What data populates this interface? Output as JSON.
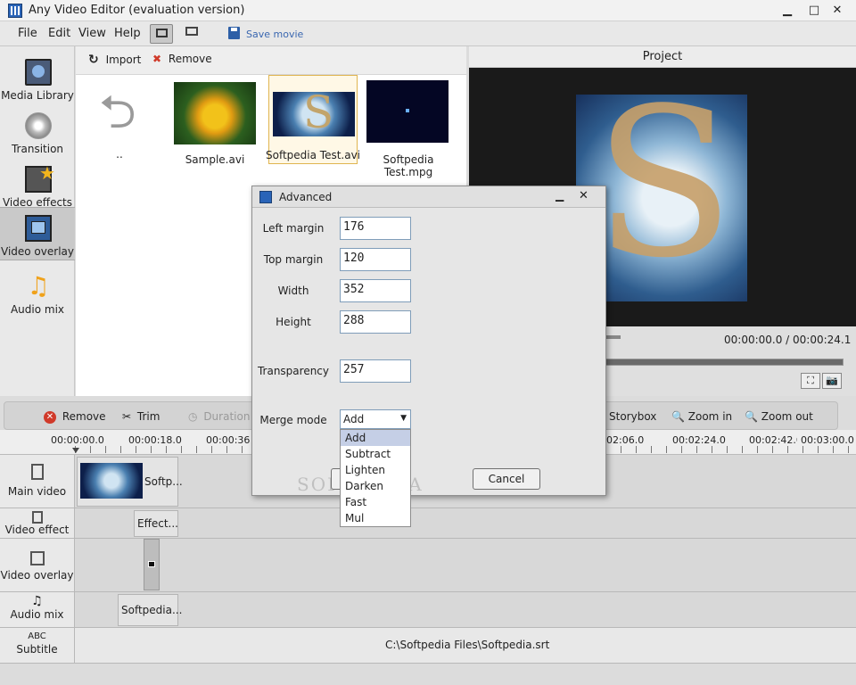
{
  "window": {
    "title": "Any Video Editor (evaluation version)"
  },
  "menu": {
    "file": "File",
    "edit": "Edit",
    "view": "View",
    "help": "Help",
    "save_movie": "Save movie"
  },
  "sidebar": {
    "items": [
      {
        "label": "Media Library"
      },
      {
        "label": "Transition"
      },
      {
        "label": "Video effects"
      },
      {
        "label": "Video overlay"
      },
      {
        "label": "Audio mix"
      }
    ]
  },
  "library": {
    "import_label": "Import",
    "remove_label": "Remove",
    "items": [
      {
        "label": ".."
      },
      {
        "label": "Sample.avi"
      },
      {
        "label": "Softpedia Test.avi"
      },
      {
        "label": "Softpedia Test.mpg"
      }
    ]
  },
  "project": {
    "header": "Project",
    "time_readout": "00:00:00.0 / 00:00:24.1"
  },
  "timeline": {
    "toolbar": {
      "remove": "Remove",
      "trim": "Trim",
      "duration": "Duration",
      "storybox": "Storybox",
      "zoom_in": "Zoom in",
      "zoom_out": "Zoom out"
    },
    "ruler": [
      "00:00:00.0",
      "00:00:18.0",
      "00:00:36.0",
      "02:06.0",
      "00:02:24.0",
      "00:02:42.0",
      "00:03:00.0"
    ],
    "tracks": {
      "main_video": "Main video",
      "video_effect": "Video effect",
      "video_overlay": "Video overlay",
      "audio_mix": "Audio mix",
      "subtitle_abc": "ABC",
      "subtitle": "Subtitle"
    },
    "clips": {
      "main": "Softp...",
      "effect": "Effect...",
      "audio": "Softpedia...",
      "subtitle_file": "C:\\Softpedia Files\\Softpedia.srt"
    }
  },
  "dialog": {
    "title": "Advanced",
    "fields": {
      "left_margin": {
        "label": "Left margin",
        "value": "176"
      },
      "top_margin": {
        "label": "Top margin",
        "value": "120"
      },
      "width": {
        "label": "Width",
        "value": "352"
      },
      "height": {
        "label": "Height",
        "value": "288"
      },
      "transparency": {
        "label": "Transparency",
        "value": "257"
      }
    },
    "merge_mode": {
      "label": "Merge mode",
      "selected": "Add",
      "options": [
        "Add",
        "Subtract",
        "Lighten",
        "Darken",
        "Fast",
        "Mul"
      ]
    },
    "cancel": "Cancel"
  },
  "watermark": "SOFTPEDIA",
  "colors": {
    "accent": "#2a64b8",
    "dropdown_highlight": "#c5cfe6",
    "remove_red": "#d03a2a"
  }
}
